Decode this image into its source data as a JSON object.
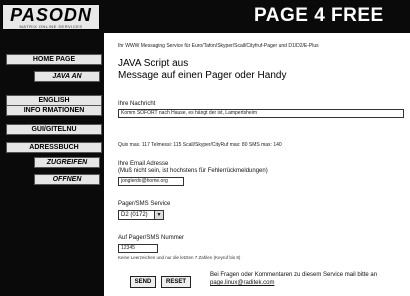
{
  "logo": {
    "text": "PASODN",
    "subtext": "MATRIX ONLINE SERVICES"
  },
  "header": {
    "title": "PAGE 4 FREE"
  },
  "nav": [
    {
      "label": "HOME PAGE"
    },
    {
      "label": "JAVA AN"
    },
    {
      "label": "ENGLISH"
    },
    {
      "label": "INFO RMATIONEN"
    },
    {
      "label": "GUI/GITELNU"
    },
    {
      "label": "ADRESSBUCH"
    },
    {
      "label": "ZUGREIFEN"
    },
    {
      "label": "OFFNEN"
    }
  ],
  "tagline": "Ihr WWW Messaging Service für Euro/Tafon/Skyper/Scall/Cityfruf-Pager und D1/D2/E-Plus",
  "heading": {
    "line1": "JAVA Script aus",
    "line2": "Message auf einen Pager oder Handy"
  },
  "message": {
    "label": "Ihre Nachricht",
    "value": "Komm SOFORT nach Hause, es hängt der ist, Lampertsheim"
  },
  "counter": "Quix max. 117  Telmessi: 115  Scall/Skyper/CityRuf max: 80  SMS max: 140",
  "email": {
    "label": "Ihre Email Adresse",
    "sublabel": "(Muß nicht sein, ist hochstens für Fehlerrückmeldungen)",
    "value": "jonglerdo@home.org"
  },
  "service": {
    "label": "Pager/SMS Service",
    "selected": "D2 (0172)"
  },
  "number": {
    "label": "Auf Pager/SMS Nummer",
    "value": "12345",
    "hint": "Keine Leerzeichen und nur die letzten 7 Zahlen (Keyruf bis 8)"
  },
  "buttons": {
    "send": "SEND",
    "reset": "RESET"
  },
  "help": {
    "text": "Bei Fragen oder Kommentaren zu diesem Service mail bitte an",
    "link": "page.linux@raditek.com"
  }
}
